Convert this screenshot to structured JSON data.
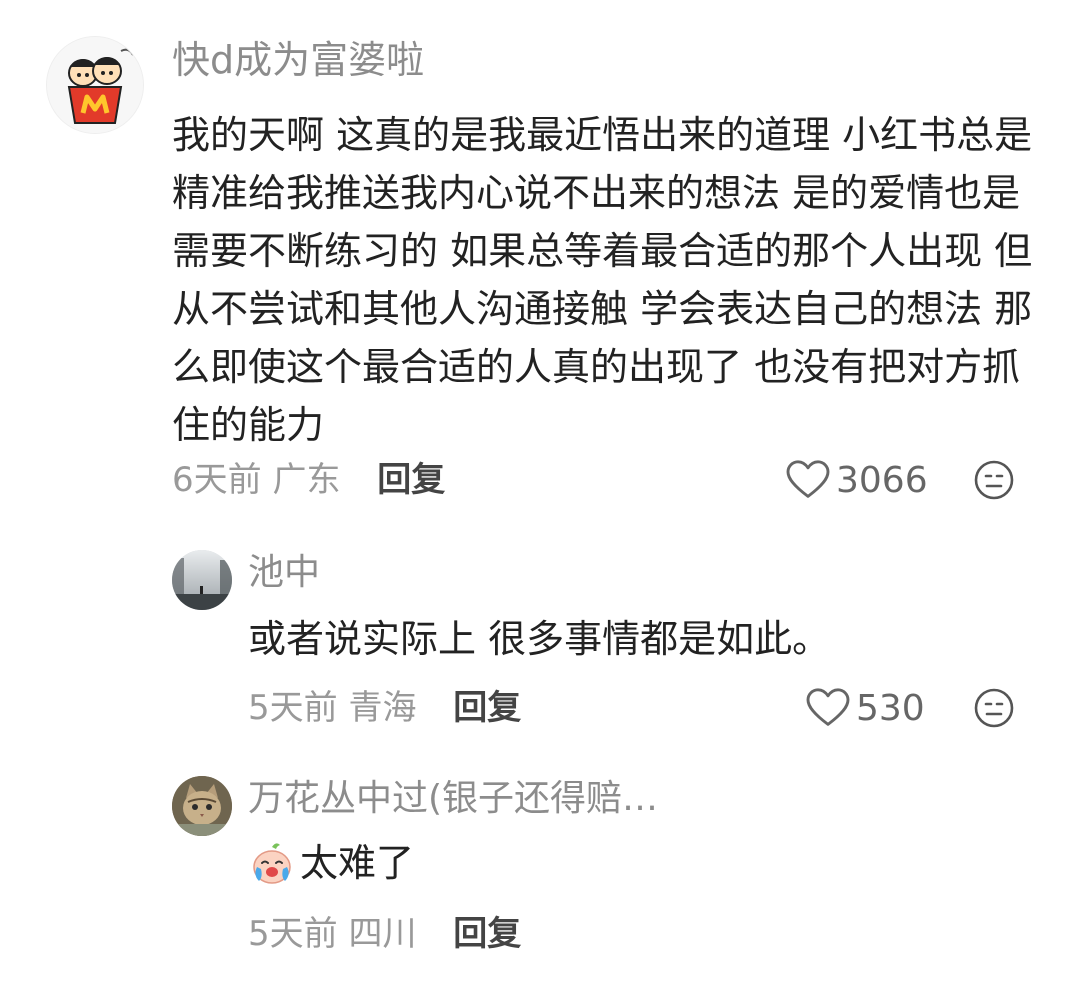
{
  "comment": {
    "username": "快d成为富婆啦",
    "text": "我的天啊 这真的是我最近悟出来的道理 小红书总是精准给我推送我内心说不出来的想法 是的爱情也是需要不断练习的 如果总等着最合适的那个人出现 但从不尝试和其他人沟通接触 学会表达自己的想法 那么即使这个最合适的人真的出现了 也没有把对方抓住的能力",
    "time": "6天前",
    "location": "广东",
    "reply_label": "回复",
    "likes": "3066"
  },
  "replies": [
    {
      "username": "池中",
      "text": "或者说实际上 很多事情都是如此。",
      "time": "5天前",
      "location": "青海",
      "reply_label": "回复",
      "likes": "530"
    },
    {
      "username": "万花丛中过(银子还得赔…",
      "text": "太难了",
      "time": "5天前",
      "location": "四川",
      "reply_label": "回复"
    }
  ]
}
